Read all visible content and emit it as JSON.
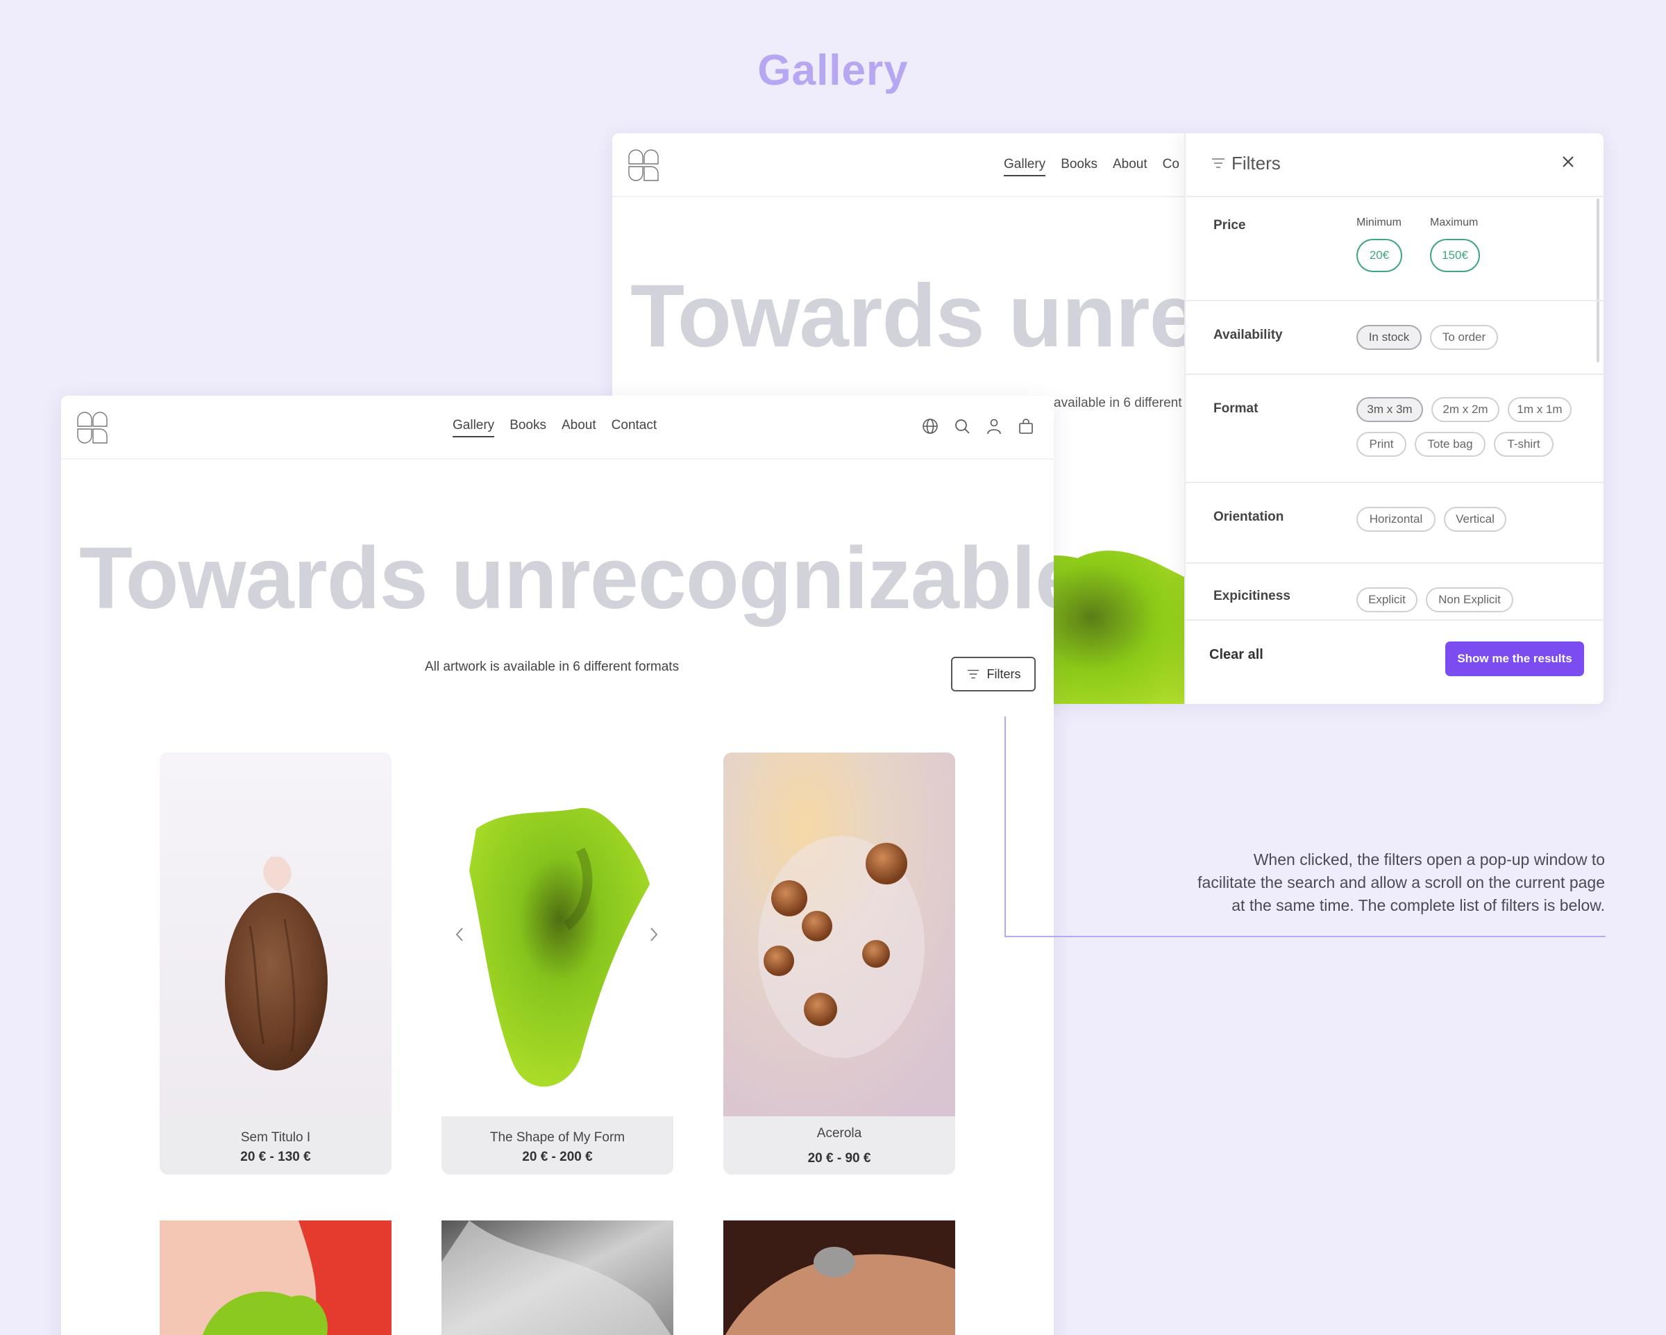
{
  "page": {
    "heading": "Gallery"
  },
  "nav": {
    "links": [
      "Gallery",
      "Books",
      "About",
      "Contact"
    ],
    "back_truncated_link": "Co"
  },
  "hero": {
    "title": "Towards unrecognizable",
    "back_title": "Towards unrec",
    "subtitle": "All artwork is available in 6 different formats",
    "back_subtitle_fragment": "available in 6 different",
    "filters_button": "Filters"
  },
  "filter_panel": {
    "title": "Filters",
    "sections": {
      "price": {
        "label": "Price",
        "min_label": "Minimum",
        "max_label": "Maximum",
        "min_value": "20€",
        "max_value": "150€"
      },
      "availability": {
        "label": "Availability",
        "options": [
          "In stock",
          "To order"
        ],
        "selected": "In stock"
      },
      "format": {
        "label": "Format",
        "options": [
          "3m x 3m",
          "2m x 2m",
          "1m x 1m",
          "Print",
          "Tote bag",
          "T-shirt"
        ],
        "selected": "3m x 3m"
      },
      "orientation": {
        "label": "Orientation",
        "options": [
          "Horizontal",
          "Vertical"
        ]
      },
      "explicitness": {
        "label": "Expicitiness",
        "options": [
          "Explicit",
          "Non Explicit"
        ]
      }
    },
    "clear_all": "Clear all",
    "show_results": "Show me the results"
  },
  "products": [
    {
      "title": "Sem Titulo I",
      "price": "20 € - 130 €"
    },
    {
      "title": "The Shape of My Form",
      "price": "20 € - 200 €"
    },
    {
      "title": "Acerola",
      "price": "20 € - 90 €"
    }
  ],
  "annotation": {
    "lines": [
      "When clicked, the filters open a pop-up window to",
      "facilitate the search and allow a scroll on the current page",
      "at the same time. The complete list of filters is below."
    ]
  },
  "colors": {
    "accent": "#7b4cf0",
    "heading": "#b7a6f2",
    "price_chip": "#3fa77b",
    "background": "#efedfb"
  },
  "icons": [
    "logo",
    "filter-icon",
    "close-icon",
    "globe-icon",
    "search-icon",
    "user-icon",
    "bag-icon",
    "chevron-left-icon",
    "chevron-right-icon"
  ]
}
